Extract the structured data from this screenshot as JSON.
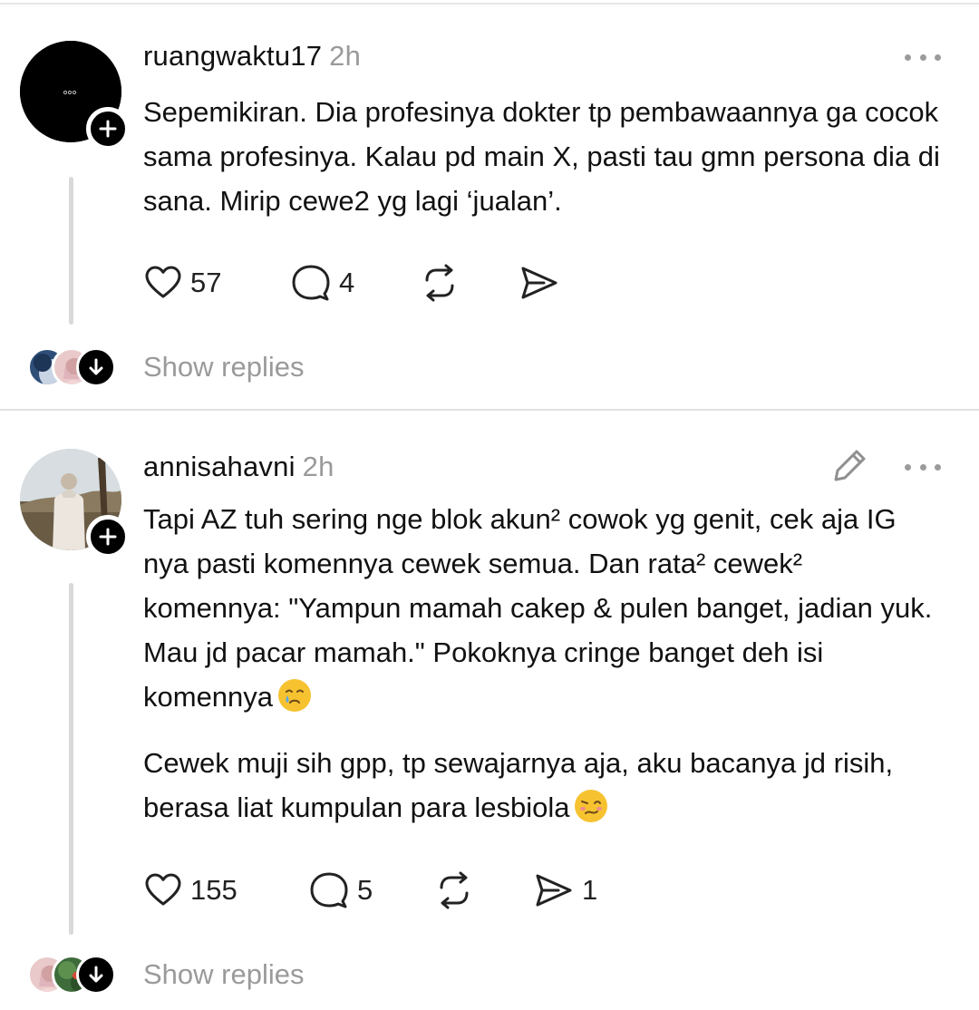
{
  "posts": [
    {
      "username": "ruangwaktu17",
      "time": "2h",
      "text": "Sepemikiran. Dia profesinya dokter tp pembawaannya ga cocok sama profesinya. Kalau pd main X, pasti tau gmn persona dia di sana. Mirip cewe2 yg lagi ‘jualan’.",
      "likes": "57",
      "comments": "4",
      "reposts": "",
      "shares": "",
      "show_replies": "Show replies"
    },
    {
      "username": "annisahavni",
      "time": "2h",
      "paragraphs": [
        "Tapi AZ tuh sering nge blok akun² cowok yg genit, cek aja IG nya pasti komennya cewek semua. Dan rata² cewek² komennya: \"Yampun mamah cakep & pulen banget, jadian yuk. Mau jd pacar mamah.\" Pokoknya cringe banget deh isi komennya",
        "Cewek muji sih gpp, tp sewajarnya aja, aku bacanya jd risih, berasa liat kumpulan para lesbiola"
      ],
      "likes": "155",
      "comments": "5",
      "reposts": "",
      "shares": "1",
      "show_replies": "Show replies"
    }
  ],
  "icons": {
    "like": "heart-icon",
    "comment": "comment-bubble-icon",
    "repost": "repost-icon",
    "share": "send-icon",
    "more": "more-dots-icon",
    "edit": "pencil-icon",
    "follow": "plus-icon",
    "expand": "arrow-down-icon",
    "emoji_1": "crying-face-emoji",
    "emoji_2": "woozy-face-emoji"
  },
  "colors": {
    "text": "#111111",
    "muted": "#9a9a9a",
    "divider": "#e1e1e1",
    "badge": "#000000",
    "emoji": "#f6c230"
  }
}
